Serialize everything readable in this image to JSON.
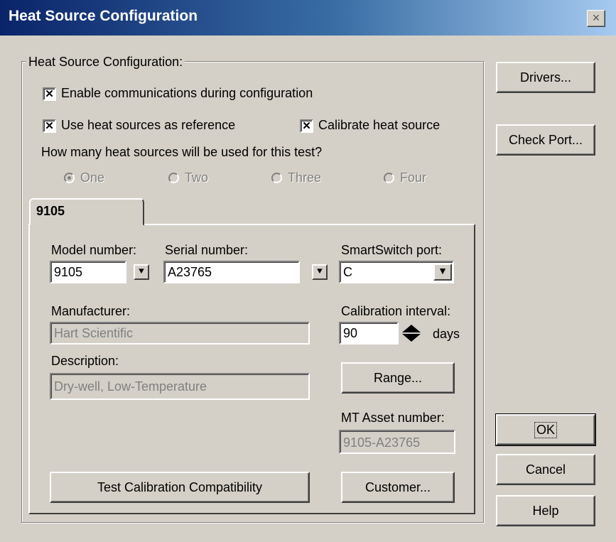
{
  "window": {
    "title": "Heat Source Configuration",
    "close_glyph": "×"
  },
  "group": {
    "label": "Heat Source Configuration:",
    "enable_comm_label": "Enable communications during configuration",
    "use_reference_label": "Use heat sources as reference",
    "calibrate_label": "Calibrate heat source",
    "question": "How many heat sources will be used for this test?",
    "radios": [
      "One",
      "Two",
      "Three",
      "Four"
    ]
  },
  "tab": {
    "label": "9105",
    "model_label": "Model number:",
    "model_value": "9105",
    "serial_label": "Serial number:",
    "serial_value": "A23765",
    "smartswitch_label": "SmartSwitch port:",
    "smartswitch_value": "C",
    "manufacturer_label": "Manufacturer:",
    "manufacturer_value": "Hart Scientific",
    "interval_label": "Calibration interval:",
    "interval_value": "90",
    "interval_unit": "days",
    "description_label": "Description:",
    "description_value": "Dry-well, Low-Temperature",
    "range_button": "Range...",
    "asset_label": "MT Asset number:",
    "asset_value": "9105-A23765",
    "test_compat_button": "Test Calibration Compatibility",
    "customer_button": "Customer..."
  },
  "side_buttons": {
    "drivers": "Drivers...",
    "check_port": "Check Port...",
    "ok": "OK",
    "cancel": "Cancel",
    "help": "Help"
  }
}
